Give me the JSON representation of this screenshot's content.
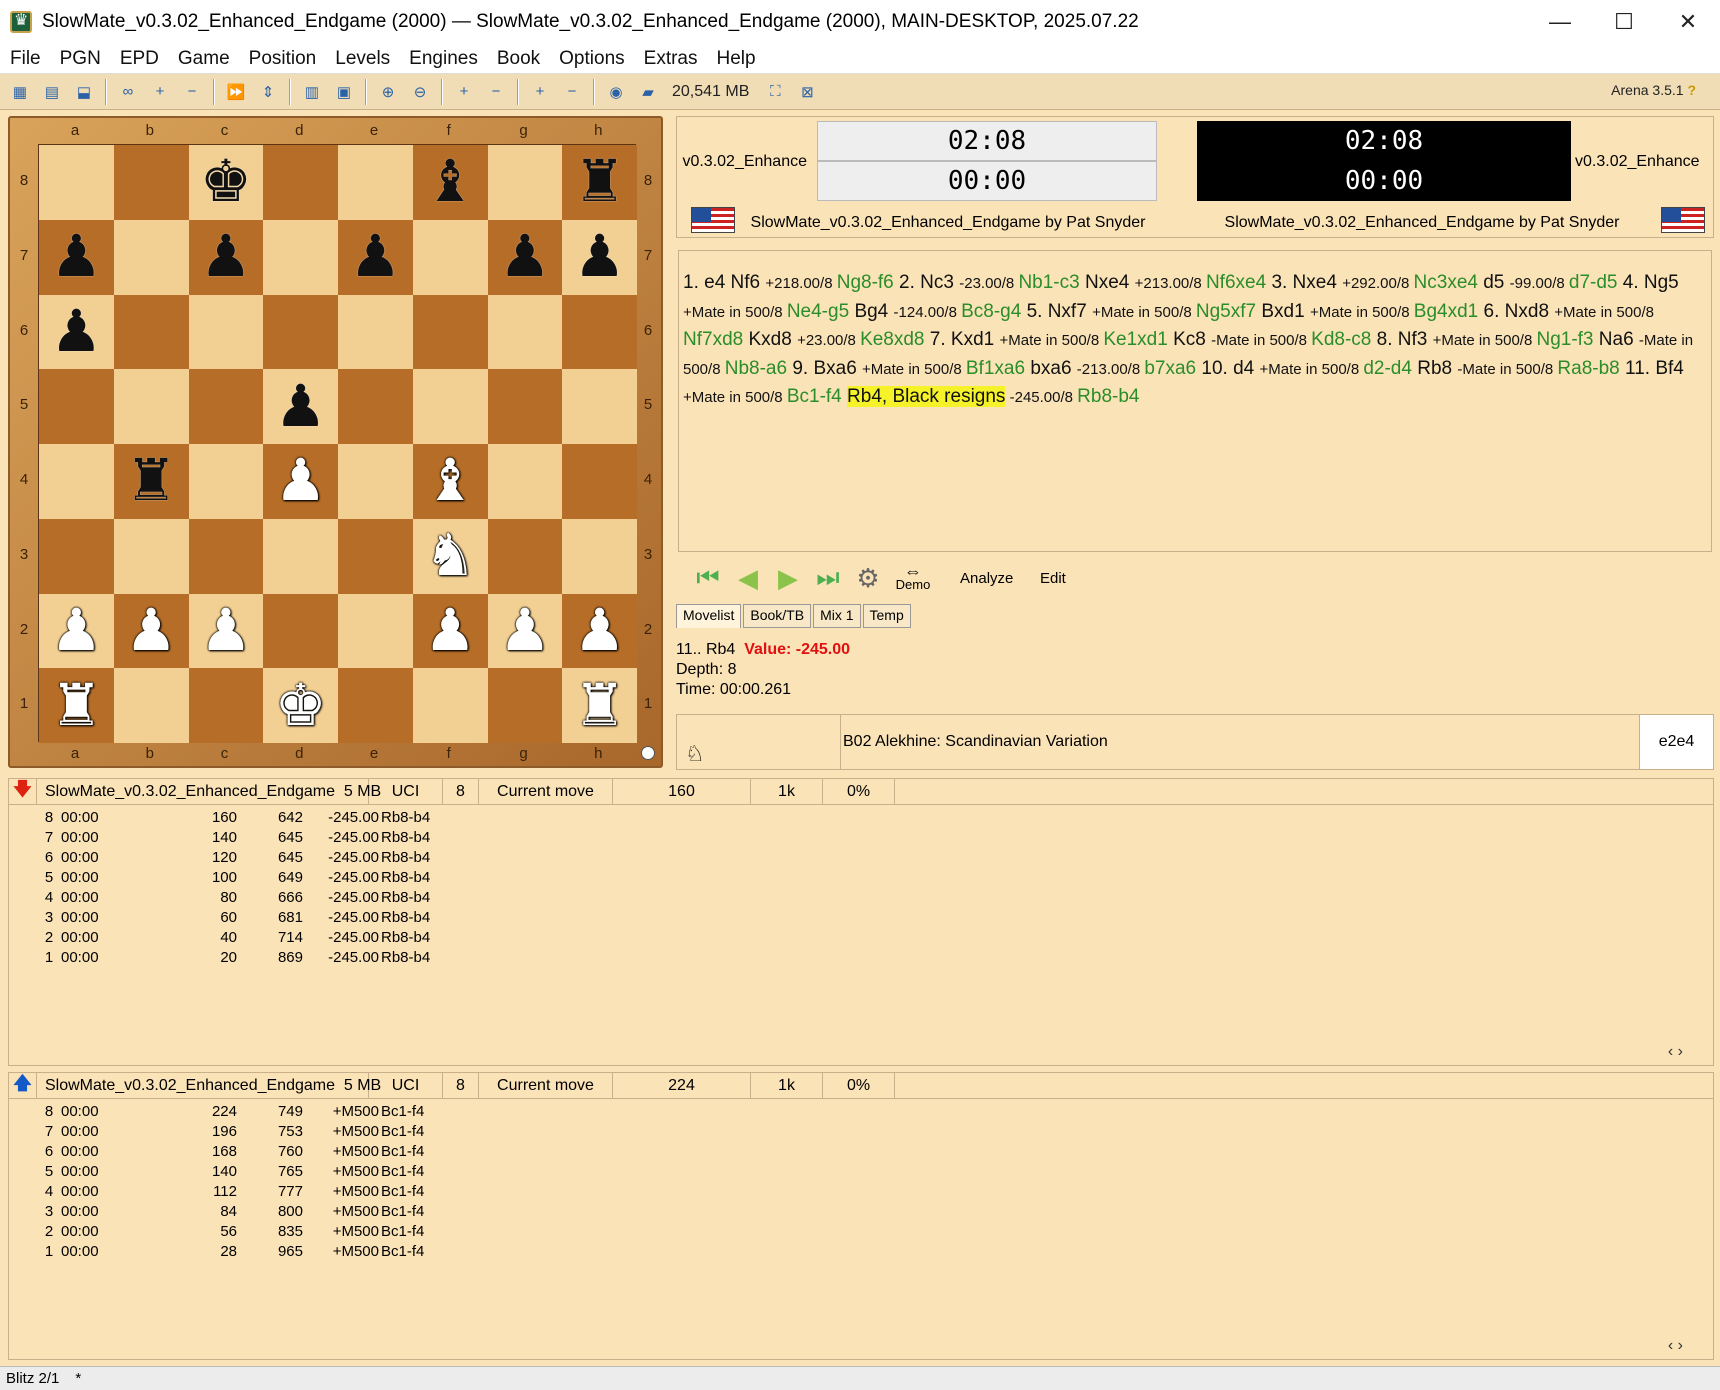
{
  "window": {
    "title": "SlowMate_v0.3.02_Enhanced_Endgame (2000)  —  SlowMate_v0.3.02_Enhanced_Endgame (2000),   MAIN-DESKTOP,   2025.07.22",
    "min": "—",
    "max": "☐",
    "close": "✕"
  },
  "menu": [
    "File",
    "PGN",
    "EPD",
    "Game",
    "Position",
    "Levels",
    "Engines",
    "Book",
    "Options",
    "Extras",
    "Help"
  ],
  "toolbar": {
    "memory": "20,541 MB",
    "version": "Arena 3.5.1",
    "help": "?"
  },
  "board": {
    "files": [
      "a",
      "b",
      "c",
      "d",
      "e",
      "f",
      "g",
      "h"
    ],
    "ranks": [
      "8",
      "7",
      "6",
      "5",
      "4",
      "3",
      "2",
      "1"
    ],
    "squares": [
      [
        "",
        "",
        "bK",
        "",
        "",
        "bB",
        "",
        "bR"
      ],
      [
        "bP",
        "",
        "bP",
        "",
        "bP",
        "",
        "bP",
        "bP"
      ],
      [
        "bP",
        "",
        "",
        "",
        "",
        "",
        "",
        ""
      ],
      [
        "",
        "",
        "",
        "bP",
        "",
        "",
        "",
        ""
      ],
      [
        "",
        "bR",
        "",
        "wP",
        "",
        "wB",
        "",
        ""
      ],
      [
        "",
        "",
        "",
        "",
        "",
        "wN",
        "",
        ""
      ],
      [
        "wP",
        "wP",
        "wP",
        "",
        "",
        "wP",
        "wP",
        "wP"
      ],
      [
        "wR",
        "",
        "",
        "wK",
        "",
        "",
        "",
        "wR"
      ]
    ],
    "glyphs": {
      "K": "♚",
      "Q": "♛",
      "R": "♜",
      "B": "♝",
      "N": "♞",
      "P": "♟"
    }
  },
  "clocks": {
    "left": {
      "name": "v0.3.02_Enhance",
      "time": "02:08",
      "move_time": "00:00",
      "byline": "SlowMate_v0.3.02_Enhanced_Endgame by Pat Snyder"
    },
    "right": {
      "name": "v0.3.02_Enhance",
      "time": "02:08",
      "move_time": "00:00",
      "byline": "SlowMate_v0.3.02_Enhanced_Endgame by Pat Snyder"
    }
  },
  "movelist": [
    {
      "t": "1. e4 Nf6 ",
      "c": "mv"
    },
    {
      "t": "+218.00/8 ",
      "c": "ev"
    },
    {
      "t": "Ng8-f6 ",
      "c": "ok"
    },
    {
      "t": "2. Nc3 ",
      "c": "mv"
    },
    {
      "t": "-23.00/8 ",
      "c": "ev"
    },
    {
      "t": "Nb1-c3 ",
      "c": "ok"
    },
    {
      "t": "Nxe4 ",
      "c": "mv"
    },
    {
      "t": "+213.00/8 ",
      "c": "ev"
    },
    {
      "t": "Nf6xe4 ",
      "c": "ok"
    },
    {
      "t": "3. Nxe4 ",
      "c": "mv"
    },
    {
      "t": "+292.00/8 ",
      "c": "ev"
    },
    {
      "t": "Nc3xe4 ",
      "c": "ok"
    },
    {
      "t": "d5 ",
      "c": "mv"
    },
    {
      "t": "-99.00/8 ",
      "c": "ev"
    },
    {
      "t": "d7-d5 ",
      "c": "ok"
    },
    {
      "t": "4. Ng5 ",
      "c": "mv"
    },
    {
      "t": "+Mate in 500/8 ",
      "c": "ev"
    },
    {
      "t": "Ne4-g5 ",
      "c": "ok"
    },
    {
      "t": "Bg4 ",
      "c": "mv"
    },
    {
      "t": "-124.00/8 ",
      "c": "ev"
    },
    {
      "t": "Bc8-g4 ",
      "c": "ok"
    },
    {
      "t": "5. Nxf7 ",
      "c": "mv"
    },
    {
      "t": "+Mate in 500/8 ",
      "c": "ev"
    },
    {
      "t": "Ng5xf7 ",
      "c": "ok"
    },
    {
      "t": "Bxd1 ",
      "c": "mv"
    },
    {
      "t": "+Mate in 500/8 ",
      "c": "ev"
    },
    {
      "t": "Bg4xd1 ",
      "c": "ok"
    },
    {
      "t": "6. Nxd8 ",
      "c": "mv"
    },
    {
      "t": "+Mate in 500/8 ",
      "c": "ev"
    },
    {
      "t": "Nf7xd8 ",
      "c": "ok"
    },
    {
      "t": "Kxd8 ",
      "c": "mv"
    },
    {
      "t": "+23.00/8 ",
      "c": "ev"
    },
    {
      "t": "Ke8xd8 ",
      "c": "ok"
    },
    {
      "t": "7. Kxd1 ",
      "c": "mv"
    },
    {
      "t": "+Mate in 500/8 ",
      "c": "ev"
    },
    {
      "t": "Ke1xd1 ",
      "c": "ok"
    },
    {
      "t": "Kc8 ",
      "c": "mv"
    },
    {
      "t": "-Mate in 500/8 ",
      "c": "ev"
    },
    {
      "t": "Kd8-c8 ",
      "c": "ok"
    },
    {
      "t": "8. Nf3 ",
      "c": "mv"
    },
    {
      "t": "+Mate in 500/8 ",
      "c": "ev"
    },
    {
      "t": "Ng1-f3 ",
      "c": "ok"
    },
    {
      "t": "Na6 ",
      "c": "mv"
    },
    {
      "t": "-Mate in 500/8 ",
      "c": "ev"
    },
    {
      "t": "Nb8-a6 ",
      "c": "ok"
    },
    {
      "t": "9. Bxa6 ",
      "c": "mv"
    },
    {
      "t": "+Mate in 500/8 ",
      "c": "ev"
    },
    {
      "t": "Bf1xa6 ",
      "c": "ok"
    },
    {
      "t": "bxa6 ",
      "c": "mv"
    },
    {
      "t": "-213.00/8 ",
      "c": "ev"
    },
    {
      "t": "b7xa6 ",
      "c": "ok"
    },
    {
      "t": "10. d4 ",
      "c": "mv"
    },
    {
      "t": "+Mate in 500/8 ",
      "c": "ev"
    },
    {
      "t": "d2-d4 ",
      "c": "ok"
    },
    {
      "t": "Rb8 ",
      "c": "mv"
    },
    {
      "t": "-Mate in 500/8 ",
      "c": "ev"
    },
    {
      "t": "Ra8-b8 ",
      "c": "ok"
    },
    {
      "t": "11. Bf4 ",
      "c": "mv"
    },
    {
      "t": "+Mate in 500/8 ",
      "c": "ev"
    },
    {
      "t": "Bc1-f4 ",
      "c": "ok"
    },
    {
      "t": "Rb4, Black resigns",
      "c": "mv hl"
    },
    {
      "t": " -245.00/8 ",
      "c": "ev"
    },
    {
      "t": "Rb8-b4",
      "c": "ok"
    }
  ],
  "nav": {
    "demo": "Demo",
    "analyze": "Analyze",
    "edit": "Edit"
  },
  "tabs": [
    "Movelist",
    "Book/TB",
    "Mix 1",
    "Temp"
  ],
  "info": {
    "move": "11.. Rb4",
    "value_label": "Value: -245.00",
    "depth": "Depth: 8",
    "time": "Time: 00:00.261"
  },
  "opening": {
    "eco": "B02  Alekhine: Scandinavian Variation",
    "move": "e2e4"
  },
  "engine1": {
    "header": {
      "name": "SlowMate_v0.3.02_Enhanced_Endgame",
      "mem": "5 MB",
      "proto": "UCI",
      "depth": "8",
      "status": "Current move",
      "nodes": "160",
      "nps": "1k",
      "load": "0%"
    },
    "rows": [
      [
        "8",
        "00:00",
        "160",
        "642",
        "-245.00",
        "Rb8-b4"
      ],
      [
        "7",
        "00:00",
        "140",
        "645",
        "-245.00",
        "Rb8-b4"
      ],
      [
        "6",
        "00:00",
        "120",
        "645",
        "-245.00",
        "Rb8-b4"
      ],
      [
        "5",
        "00:00",
        "100",
        "649",
        "-245.00",
        "Rb8-b4"
      ],
      [
        "4",
        "00:00",
        "80",
        "666",
        "-245.00",
        "Rb8-b4"
      ],
      [
        "3",
        "00:00",
        "60",
        "681",
        "-245.00",
        "Rb8-b4"
      ],
      [
        "2",
        "00:00",
        "40",
        "714",
        "-245.00",
        "Rb8-b4"
      ],
      [
        "1",
        "00:00",
        "20",
        "869",
        "-245.00",
        "Rb8-b4"
      ]
    ]
  },
  "engine2": {
    "header": {
      "name": "SlowMate_v0.3.02_Enhanced_Endgame",
      "mem": "5 MB",
      "proto": "UCI",
      "depth": "8",
      "status": "Current move",
      "nodes": "224",
      "nps": "1k",
      "load": "0%"
    },
    "rows": [
      [
        "8",
        "00:00",
        "224",
        "749",
        "+M500",
        "Bc1-f4"
      ],
      [
        "7",
        "00:00",
        "196",
        "753",
        "+M500",
        "Bc1-f4"
      ],
      [
        "6",
        "00:00",
        "168",
        "760",
        "+M500",
        "Bc1-f4"
      ],
      [
        "5",
        "00:00",
        "140",
        "765",
        "+M500",
        "Bc1-f4"
      ],
      [
        "4",
        "00:00",
        "112",
        "777",
        "+M500",
        "Bc1-f4"
      ],
      [
        "3",
        "00:00",
        "84",
        "800",
        "+M500",
        "Bc1-f4"
      ],
      [
        "2",
        "00:00",
        "56",
        "835",
        "+M500",
        "Bc1-f4"
      ],
      [
        "1",
        "00:00",
        "28",
        "965",
        "+M500",
        "Bc1-f4"
      ]
    ]
  },
  "status": {
    "mode": "Blitz 2/1",
    "modified": "*"
  }
}
